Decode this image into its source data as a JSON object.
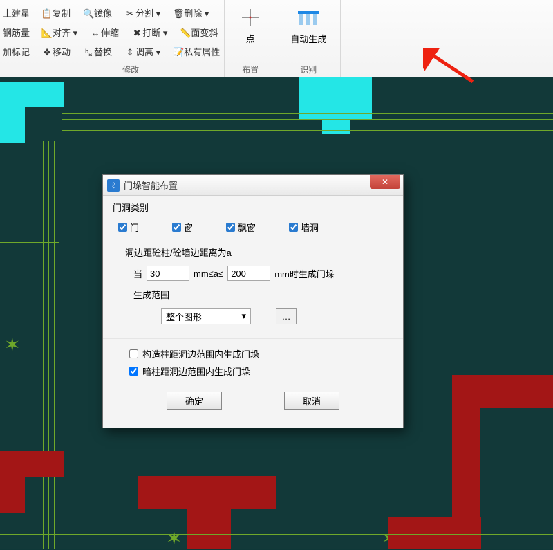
{
  "ribbon": {
    "col1": {
      "a": "土建量",
      "b": "钢筋量",
      "c": "加标记"
    },
    "col2": {
      "row1": [
        "复制",
        "镜像",
        "分割",
        "删除"
      ],
      "row2": [
        "对齐",
        "伸缩",
        "打断",
        "面变斜"
      ],
      "row3": [
        "移动",
        "替换",
        "调高",
        "私有属性"
      ],
      "groupLabel": "修改"
    },
    "big1": {
      "line1": "点",
      "line2": "布置"
    },
    "big2": {
      "line1": "自动生成",
      "line2": "识别"
    }
  },
  "dialog": {
    "title": "门垛智能布置",
    "categoryHeading": "门洞类别",
    "categories": [
      {
        "label": "门",
        "checked": true
      },
      {
        "label": "窗",
        "checked": true
      },
      {
        "label": "飘窗",
        "checked": true
      },
      {
        "label": "墙洞",
        "checked": true
      }
    ],
    "distanceHeading": "洞边距砼柱/砼墙边距离为a",
    "when": "当",
    "valA": "30",
    "mid": "mm≤a≤",
    "valB": "200",
    "tail": "mm时生成门垛",
    "rangeLabel": "生成范围",
    "rangeSelected": "整个图形",
    "opt1": {
      "label": "构造柱距洞边范围内生成门垛",
      "checked": false
    },
    "opt2": {
      "label": "暗柱距洞边范围内生成门垛",
      "checked": true
    },
    "ok": "确定",
    "cancel": "取消"
  }
}
